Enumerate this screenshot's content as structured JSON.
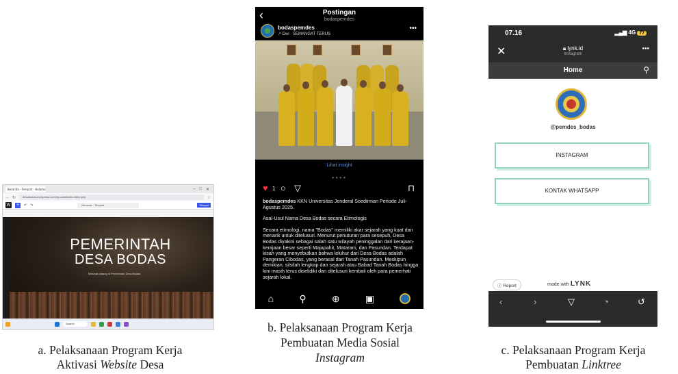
{
  "panel_a": {
    "tab_title": "Beranda · Templat · Halaman ▾",
    "url": "desabodas.wordpress.com/wp-admin/site-editor.php",
    "doc_name": "Beranda · Templat",
    "save_label": "Simpan",
    "hero_line1": "PEMERINTAH",
    "hero_line2": "DESA BODAS",
    "hero_sub": "Selamat datang di Pemerintah Desa Bodas",
    "taskbar_search": "Search"
  },
  "panel_b": {
    "header_title": "Postingan",
    "header_sub": "bodaspemdes",
    "username": "bodaspemdes",
    "audio": "↗ Dwi · SEMANGAT TERUS",
    "insight": "Lihat insight",
    "like_count": "1",
    "caption_user": "bodaspemdes",
    "caption_lead": "KKN Universitas Jenderal Soedirman Periode Juli-Agustus 2025.",
    "caption_heading": "Asal-Usul Nama Desa Bodas secara Etimologis",
    "caption_body": "Secara etimologi, nama \"Bodas\" memiliki akar sejarah yang kuat dan menarik untuk ditelusuri. Menurut penuturan para sesepuh, Desa Bodas diyakini sebagai salah satu wilayah peninggalan dari kerajaan-kerajaan besar seperti Majapahit, Mataram, dan Pasundan. Terdapat kisah yang menyebutkan bahwa leluhur dari Desa Bodas adalah Pangeran Cibodas, yang berasal dari Tanah Pasundan. Meskipun demikian, silsilah lengkap dan sejarah atau Babad Tanah Bodas hingga kini masih terus diselidiki dan ditelusuri kembali oleh para pemerhati sejarah lokal."
  },
  "panel_c": {
    "time": "07.16",
    "signal": "4G",
    "battery": "77",
    "domain": "lynk.id",
    "source": "Instagram",
    "home_title": "Home",
    "handle": "@pemdes_bodas",
    "links": [
      "INSTAGRAM",
      "KONTAK WHATSAPP"
    ],
    "report": "Report",
    "made_with": "made with",
    "brand": "LYNK"
  },
  "captions": {
    "a_line1": "a. Pelaksanaan Program Kerja",
    "a_line2_pre": "Aktivasi ",
    "a_line2_em": "Website",
    "a_line2_post": " Desa",
    "b_line1": "b. Pelaksanaan Program Kerja",
    "b_line2": "Pembuatan Media Sosial",
    "b_line3_em": "Instagram",
    "c_line1": "c. Pelaksanaan Program Kerja",
    "c_line2_pre": "Pembuatan ",
    "c_line2_em": "Linktree"
  }
}
